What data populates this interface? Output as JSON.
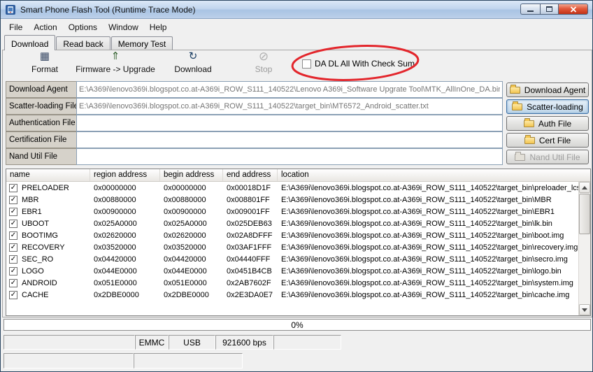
{
  "window": {
    "title": "Smart Phone Flash Tool (Runtime Trace Mode)"
  },
  "menu": {
    "items": [
      "File",
      "Action",
      "Options",
      "Window",
      "Help"
    ]
  },
  "tabs": [
    {
      "label": "Download",
      "active": true
    },
    {
      "label": "Read back",
      "active": false
    },
    {
      "label": "Memory Test",
      "active": false
    }
  ],
  "toolbar": {
    "format_label": "Format",
    "firmware_upgrade_label": "Firmware -> Upgrade",
    "download_label": "Download",
    "stop_label": "Stop",
    "stop_state": "disabled",
    "da_checksum": {
      "label": "DA DL All With Check Sum",
      "checked": false
    }
  },
  "icons": {
    "format": "▦",
    "firmware_upgrade": "⇑",
    "download": "↻",
    "stop": "⊘",
    "check": "✓"
  },
  "annotation": {
    "shape": "ellipse",
    "color": "#e3262c",
    "highlights": "da-checksum-checkbox"
  },
  "file_fields": [
    {
      "label": "Download Agent",
      "value": "E:\\A369i\\lenovo369i.blogspot.co.at-A369i_ROW_S111_140522\\Lenovo A369i_Software Upgrate Tool\\MTK_AllInOne_DA.bin"
    },
    {
      "label": "Scatter-loading File",
      "value": "E:\\A369i\\lenovo369i.blogspot.co.at-A369i_ROW_S111_140522\\target_bin\\MT6572_Android_scatter.txt"
    },
    {
      "label": "Authentication File",
      "value": ""
    },
    {
      "label": "Certification File",
      "value": ""
    },
    {
      "label": "Nand Util File",
      "value": ""
    }
  ],
  "side_buttons": [
    {
      "label": "Download Agent",
      "state": "normal"
    },
    {
      "label": "Scatter-loading",
      "state": "active"
    },
    {
      "label": "Auth File",
      "state": "normal"
    },
    {
      "label": "Cert File",
      "state": "normal"
    },
    {
      "label": "Nand Util File",
      "state": "disabled"
    }
  ],
  "table": {
    "columns": [
      "name",
      "region address",
      "begin address",
      "end address",
      "location"
    ],
    "rows": [
      {
        "checked": true,
        "name": "PRELOADER",
        "region_address": "0x00000000",
        "begin_address": "0x00000000",
        "end_address": "0x00018D1F",
        "location": "E:\\A369i\\lenovo369i.blogspot.co.at-A369i_ROW_S111_140522\\target_bin\\preloader_lcsh"
      },
      {
        "checked": true,
        "name": "MBR",
        "region_address": "0x00880000",
        "begin_address": "0x00880000",
        "end_address": "0x008801FF",
        "location": "E:\\A369i\\lenovo369i.blogspot.co.at-A369i_ROW_S111_140522\\target_bin\\MBR"
      },
      {
        "checked": true,
        "name": "EBR1",
        "region_address": "0x00900000",
        "begin_address": "0x00900000",
        "end_address": "0x009001FF",
        "location": "E:\\A369i\\lenovo369i.blogspot.co.at-A369i_ROW_S111_140522\\target_bin\\EBR1"
      },
      {
        "checked": true,
        "name": "UBOOT",
        "region_address": "0x025A0000",
        "begin_address": "0x025A0000",
        "end_address": "0x025DEB63",
        "location": "E:\\A369i\\lenovo369i.blogspot.co.at-A369i_ROW_S111_140522\\target_bin\\lk.bin"
      },
      {
        "checked": true,
        "name": "BOOTIMG",
        "region_address": "0x02620000",
        "begin_address": "0x02620000",
        "end_address": "0x02A8DFFF",
        "location": "E:\\A369i\\lenovo369i.blogspot.co.at-A369i_ROW_S111_140522\\target_bin\\boot.img"
      },
      {
        "checked": true,
        "name": "RECOVERY",
        "region_address": "0x03520000",
        "begin_address": "0x03520000",
        "end_address": "0x03AF1FFF",
        "location": "E:\\A369i\\lenovo369i.blogspot.co.at-A369i_ROW_S111_140522\\target_bin\\recovery.img"
      },
      {
        "checked": true,
        "name": "SEC_RO",
        "region_address": "0x04420000",
        "begin_address": "0x04420000",
        "end_address": "0x04440FFF",
        "location": "E:\\A369i\\lenovo369i.blogspot.co.at-A369i_ROW_S111_140522\\target_bin\\secro.img"
      },
      {
        "checked": true,
        "name": "LOGO",
        "region_address": "0x044E0000",
        "begin_address": "0x044E0000",
        "end_address": "0x0451B4CB",
        "location": "E:\\A369i\\lenovo369i.blogspot.co.at-A369i_ROW_S111_140522\\target_bin\\logo.bin"
      },
      {
        "checked": true,
        "name": "ANDROID",
        "region_address": "0x051E0000",
        "begin_address": "0x051E0000",
        "end_address": "0x2AB7602F",
        "location": "E:\\A369i\\lenovo369i.blogspot.co.at-A369i_ROW_S111_140522\\target_bin\\system.img"
      },
      {
        "checked": true,
        "name": "CACHE",
        "region_address": "0x2DBE0000",
        "begin_address": "0x2DBE0000",
        "end_address": "0x2E3DA0E7",
        "location": "E:\\A369i\\lenovo369i.blogspot.co.at-A369i_ROW_S111_140522\\target_bin\\cache.img"
      }
    ]
  },
  "progress": {
    "label": "0%"
  },
  "status_bar": {
    "storage": "EMMC",
    "port": "USB",
    "baud": "921600 bps"
  }
}
